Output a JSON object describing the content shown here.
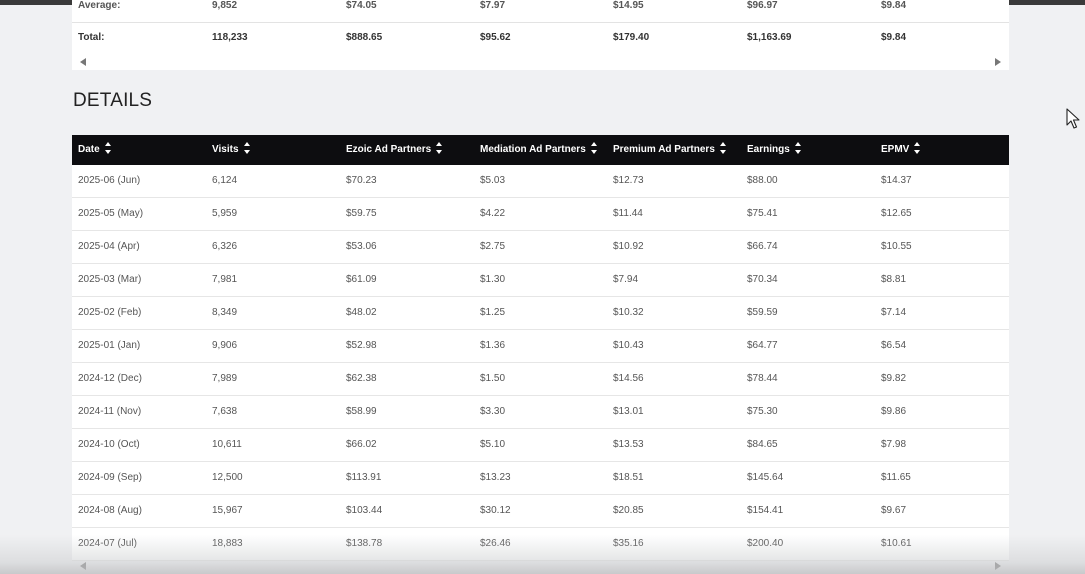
{
  "summary": {
    "average": {
      "label": "Average:",
      "values": [
        "9,852",
        "$74.05",
        "$7.97",
        "$14.95",
        "$96.97",
        "$9.84"
      ]
    },
    "total": {
      "label": "Total:",
      "values": [
        "118,233",
        "$888.65",
        "$95.62",
        "$179.40",
        "$1,163.69",
        "$9.84"
      ]
    }
  },
  "details": {
    "title": "DETAILS",
    "columns": [
      "Date",
      "Visits",
      "Ezoic Ad Partners",
      "Mediation Ad Partners",
      "Premium Ad Partners",
      "Earnings",
      "EPMV"
    ],
    "rows": [
      [
        "2025-06 (Jun)",
        "6,124",
        "$70.23",
        "$5.03",
        "$12.73",
        "$88.00",
        "$14.37"
      ],
      [
        "2025-05 (May)",
        "5,959",
        "$59.75",
        "$4.22",
        "$11.44",
        "$75.41",
        "$12.65"
      ],
      [
        "2025-04 (Apr)",
        "6,326",
        "$53.06",
        "$2.75",
        "$10.92",
        "$66.74",
        "$10.55"
      ],
      [
        "2025-03 (Mar)",
        "7,981",
        "$61.09",
        "$1.30",
        "$7.94",
        "$70.34",
        "$8.81"
      ],
      [
        "2025-02 (Feb)",
        "8,349",
        "$48.02",
        "$1.25",
        "$10.32",
        "$59.59",
        "$7.14"
      ],
      [
        "2025-01 (Jan)",
        "9,906",
        "$52.98",
        "$1.36",
        "$10.43",
        "$64.77",
        "$6.54"
      ],
      [
        "2024-12 (Dec)",
        "7,989",
        "$62.38",
        "$1.50",
        "$14.56",
        "$78.44",
        "$9.82"
      ],
      [
        "2024-11 (Nov)",
        "7,638",
        "$58.99",
        "$3.30",
        "$13.01",
        "$75.30",
        "$9.86"
      ],
      [
        "2024-10 (Oct)",
        "10,611",
        "$66.02",
        "$5.10",
        "$13.53",
        "$84.65",
        "$7.98"
      ],
      [
        "2024-09 (Sep)",
        "12,500",
        "$113.91",
        "$13.23",
        "$18.51",
        "$145.64",
        "$11.65"
      ],
      [
        "2024-08 (Aug)",
        "15,967",
        "$103.44",
        "$30.12",
        "$20.85",
        "$154.41",
        "$9.67"
      ],
      [
        "2024-07 (Jul)",
        "18,883",
        "$138.78",
        "$26.46",
        "$35.16",
        "$200.40",
        "$10.61"
      ]
    ]
  },
  "icons": {
    "sort": "sort-icon",
    "scroll_left": "scroll-left-icon",
    "scroll_right": "scroll-right-icon",
    "cursor": "mouse-pointer-icon"
  }
}
